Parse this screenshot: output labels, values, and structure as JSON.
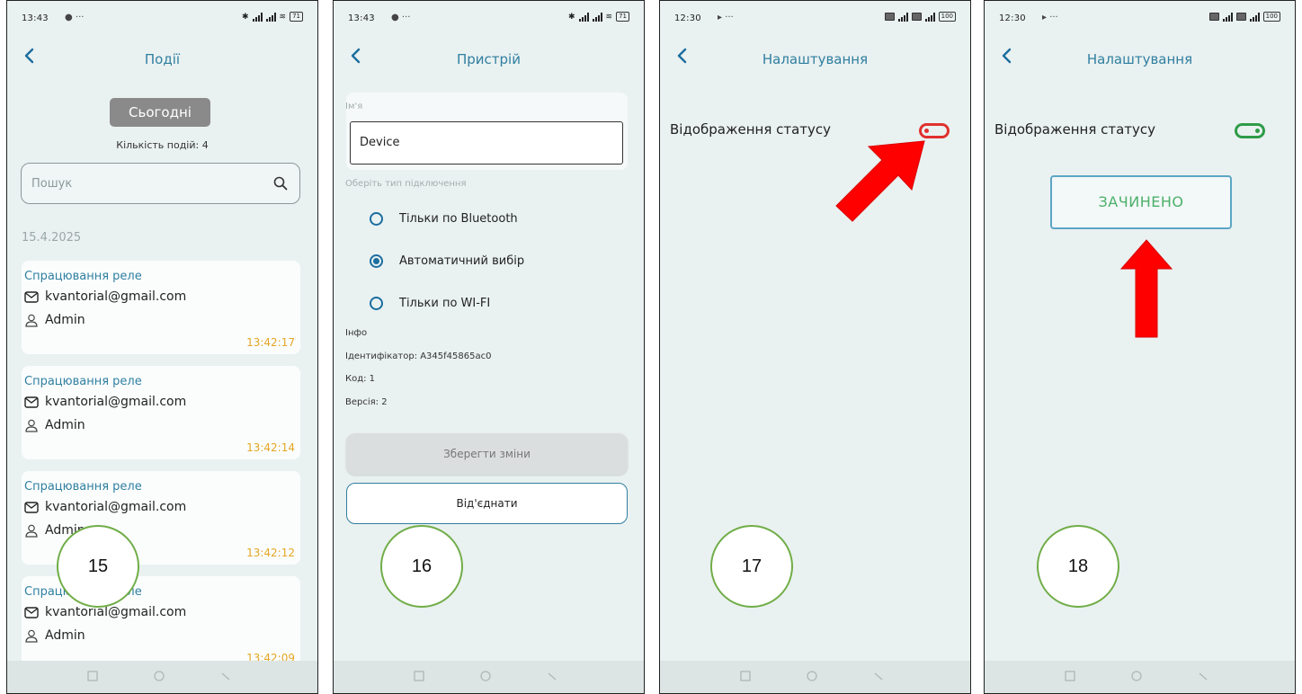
{
  "screen15": {
    "status_time": "13:43",
    "title": "Події",
    "today_button": "Сьогодні",
    "events_count": "Кількість подій: 4",
    "search_placeholder": "Пошук",
    "date": "15.4.2025",
    "events": [
      {
        "type": "Спрацювання реле",
        "email": "kvantorial@gmail.com",
        "user": "Admin",
        "time": "13:42:17"
      },
      {
        "type": "Спрацювання реле",
        "email": "kvantorial@gmail.com",
        "user": "Admin",
        "time": "13:42:14"
      },
      {
        "type": "Спрацювання реле",
        "email": "kvantorial@gmail.com",
        "user": "Admin",
        "time": "13:42:12"
      },
      {
        "type": "Спрацювання реле",
        "email": "kvantorial@gmail.com",
        "user": "Admin",
        "time": "13:42:09"
      }
    ],
    "step_number": "15"
  },
  "screen16": {
    "status_time": "13:43",
    "title": "Пристрій",
    "name_label": "Ім'я",
    "name_value": "Device",
    "connection_label": "Оберіть тип підключення",
    "options": [
      "Тільки по Bluetooth",
      "Автоматичний вибір",
      "Тільки по WI-FI"
    ],
    "selected_option": "Автоматичний вибір",
    "info_heading": "Інфо",
    "identifier": "Ідентифікатор: A345f45865ac0",
    "code": "Код: 1",
    "version": "Версія: 2",
    "save_button": "Зберегти зміни",
    "disconnect_button": "Від'єднати",
    "step_number": "16"
  },
  "screen17": {
    "status_time": "12:30",
    "title": "Налаштування",
    "status_label": "Відображення статусу",
    "toggle_on": false,
    "step_number": "17"
  },
  "screen18": {
    "status_time": "12:30",
    "title": "Налаштування",
    "status_label": "Відображення статусу",
    "toggle_on": true,
    "closed_button": "ЗАЧИНЕНО",
    "step_number": "18"
  },
  "status_bar": {
    "battery_left": "71",
    "battery_right": "100"
  },
  "colors": {
    "accent": "#2f7fa0",
    "time": "#e5a624",
    "toggle_off": "#e0312e",
    "toggle_on": "#2e9c47",
    "arrow": "#ff0000",
    "circle": "#70ad47"
  }
}
